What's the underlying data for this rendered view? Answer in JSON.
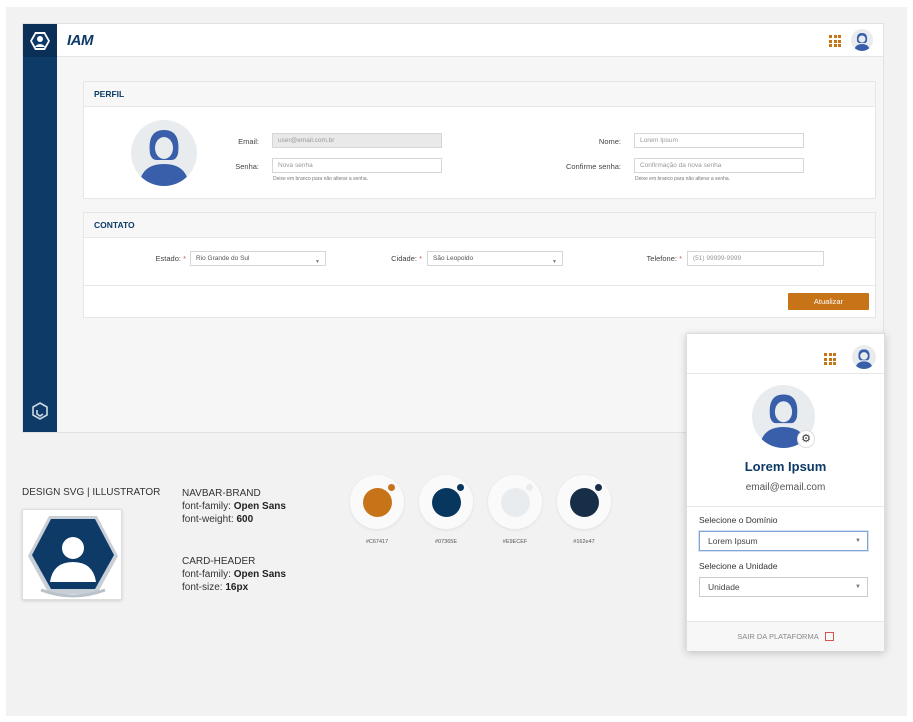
{
  "app": {
    "brand": "IAM"
  },
  "perfil": {
    "header": "PERFIL",
    "email_label": "Email:",
    "email_value": "user@email.com.br",
    "senha_label": "Senha:",
    "senha_placeholder": "Nova senha",
    "senha_hint": "Deixe em branco para não alterar a senha.",
    "nome_label": "Nome:",
    "nome_placeholder": "Lorem Ipsum",
    "confirme_label": "Confirme senha:",
    "confirme_placeholder": "Confirmação da nova senha",
    "confirme_hint": "Deixe em branco para não alterar a senha."
  },
  "contato": {
    "header": "CONTATO",
    "estado_label": "Estado:",
    "estado_value": "Rio Grande do Sul",
    "cidade_label": "Cidade:",
    "cidade_value": "São Leopoldo",
    "telefone_label": "Telefone:",
    "telefone_placeholder": "(51) 99999-9999",
    "required_mark": "*"
  },
  "actions": {
    "update": "Atualizar"
  },
  "design": {
    "logo_title": "DESIGN SVG | ILLUSTRATOR",
    "navbar": {
      "title": "NAVBAR-BRAND",
      "family_label": "font-family:",
      "family_value": "Open Sans",
      "weight_label": "font-weight:",
      "weight_value": "600"
    },
    "cardheader": {
      "title": "CARD-HEADER",
      "family_label": "font-family:",
      "family_value": "Open Sans",
      "size_label": "font-size:",
      "size_value": "16px"
    },
    "swatches": [
      {
        "color": "#c67417",
        "label": "#C67417"
      },
      {
        "color": "#07365e",
        "label": "#07365E"
      },
      {
        "color": "#e9ecef",
        "label": "#E9ECEF"
      },
      {
        "color": "#162e47",
        "label": "#162e47"
      }
    ]
  },
  "user_panel": {
    "name": "Lorem Ipsum",
    "email": "email@email.com",
    "domain_label": "Selecione o Domínio",
    "domain_value": "Lorem Ipsum",
    "unit_label": "Selecione a Unidade",
    "unit_value": "Unidade",
    "logout": "SAIR DA PLATAFORMA"
  },
  "icons": [
    "user-avatar-icon",
    "apps-grid-icon",
    "logo-icon",
    "gear-icon",
    "exit-icon",
    "chevron-down-icon"
  ],
  "colors": {
    "primary": "#0d3a66",
    "accent": "#c67417",
    "light": "#e9ecef",
    "dark": "#162e47"
  }
}
